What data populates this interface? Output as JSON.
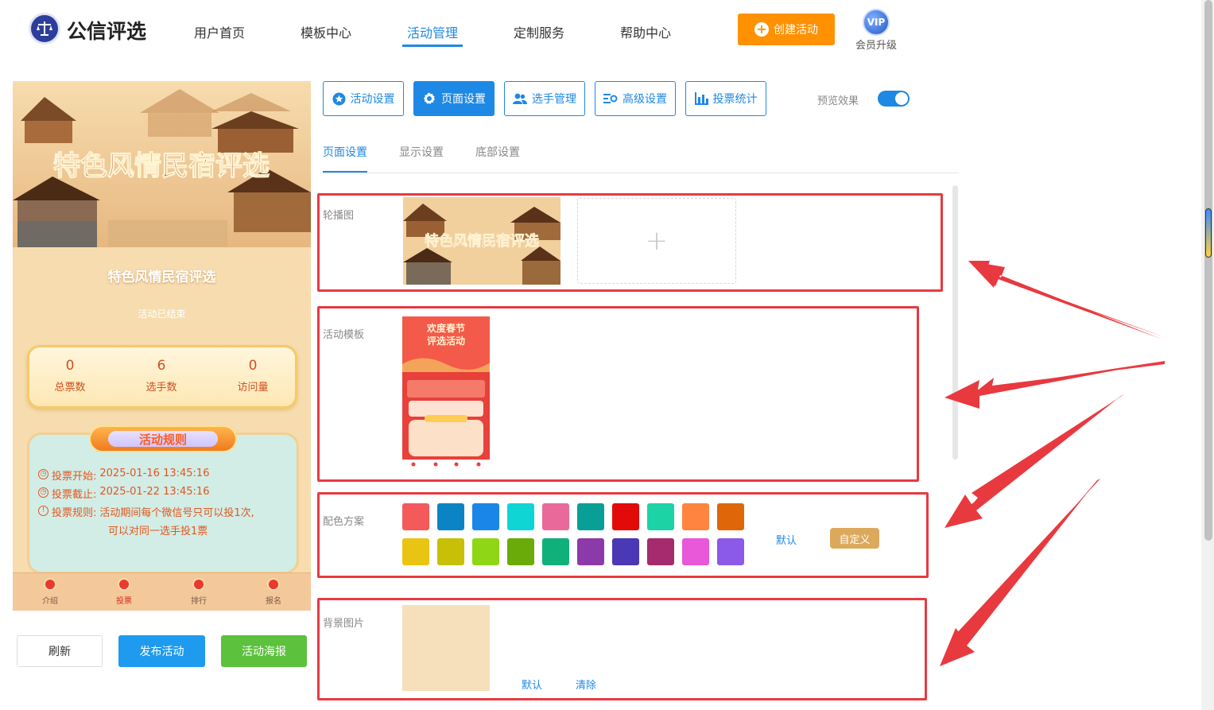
{
  "header": {
    "logo_text": "公信评选",
    "nav": [
      "用户首页",
      "模板中心",
      "活动管理",
      "定制服务",
      "帮助中心"
    ],
    "active_nav": "活动管理",
    "create_button": "创建活动",
    "vip_badge": "VIP",
    "vip_label": "会员升级",
    "accent_color": "#1e88e5",
    "create_color": "#ff9100"
  },
  "preview": {
    "banner_title": "特色风情民宿评选",
    "title": "特色风情民宿评选",
    "status": "活动已结束",
    "stats": [
      {
        "value": "0",
        "label": "总票数"
      },
      {
        "value": "6",
        "label": "选手数"
      },
      {
        "value": "0",
        "label": "访问量"
      }
    ],
    "rules_title": "活动规则",
    "rules": [
      {
        "icon": "clock-icon",
        "label": "投票开始:",
        "value": "2025-01-16 13:45:16"
      },
      {
        "icon": "clock-icon",
        "label": "投票截止:",
        "value": "2025-01-22 13:45:16"
      },
      {
        "icon": "info-icon",
        "label": "投票规则:",
        "value": "活动期间每个微信号只可以投1次,",
        "value2": "可以对同一选手投1票"
      }
    ],
    "tabbar": [
      "介绍",
      "投票",
      "排行",
      "报名"
    ],
    "active_tab": "投票"
  },
  "left_actions": {
    "refresh": "刷新",
    "publish": "发布活动",
    "poster": "活动海报"
  },
  "settings_tabs": [
    {
      "label": "活动设置",
      "icon": "star-icon"
    },
    {
      "label": "页面设置",
      "icon": "gear-icon"
    },
    {
      "label": "选手管理",
      "icon": "users-icon"
    },
    {
      "label": "高级设置",
      "icon": "sliders-icon"
    },
    {
      "label": "投票统计",
      "icon": "bar-chart-icon"
    }
  ],
  "active_settings_tab": "页面设置",
  "preview_toggle": {
    "label": "预览效果",
    "on": true
  },
  "sub_tabs": [
    "页面设置",
    "显示设置",
    "底部设置"
  ],
  "active_sub_tab": "页面设置",
  "sections": {
    "carousel": {
      "label": "轮播图",
      "thumb_title": "特色风情民宿评选",
      "add_icon": "+"
    },
    "template": {
      "label": "活动模板",
      "thumb_title_1": "欢度春节",
      "thumb_title_2": "评选活动"
    },
    "colors": {
      "label": "配色方案",
      "row1": [
        "#f55a5a",
        "#0a84c4",
        "#1a86e8",
        "#10d5d5",
        "#e96a9a",
        "#089f97",
        "#e30a0a",
        "#1bd3a5",
        "#ff8440",
        "#e0660a"
      ],
      "row2": [
        "#eac412",
        "#c7c007",
        "#8fd616",
        "#6aab0a",
        "#10b07a",
        "#8c3aaa",
        "#4a38b4",
        "#a52a6e",
        "#e858d8",
        "#8c5ae8"
      ],
      "default_link": "默认",
      "custom_button": "自定义"
    },
    "background": {
      "label": "背景图片",
      "default_link": "默认",
      "clear_link": "清除",
      "color": "#f6dfbb"
    }
  }
}
